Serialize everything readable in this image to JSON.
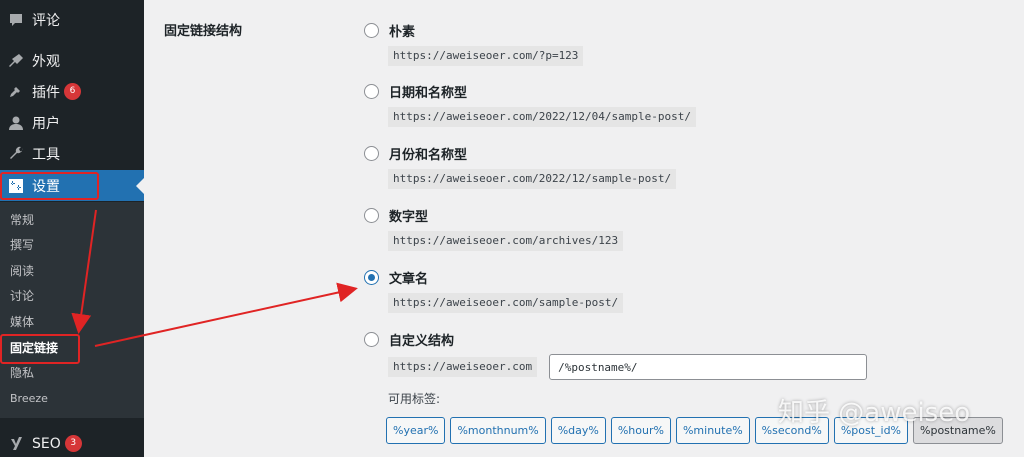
{
  "sidebar": {
    "items": [
      {
        "label": "评论",
        "icon": "comment-icon"
      },
      {
        "label": "外观",
        "icon": "appearance-icon"
      },
      {
        "label": "插件",
        "icon": "plugins-icon",
        "badge": "6"
      },
      {
        "label": "用户",
        "icon": "users-icon"
      },
      {
        "label": "工具",
        "icon": "tools-icon"
      },
      {
        "label": "设置",
        "icon": "settings-icon"
      },
      {
        "label": "SEO",
        "icon": "yoast-icon",
        "badge": "3"
      }
    ],
    "submenu": [
      "常规",
      "撰写",
      "阅读",
      "讨论",
      "媒体",
      "固定链接",
      "隐私",
      "Breeze"
    ]
  },
  "permalink": {
    "section_label": "固定链接结构",
    "options": [
      {
        "label": "朴素",
        "example": "https://aweiseoer.com/?p=123",
        "checked": false
      },
      {
        "label": "日期和名称型",
        "example": "https://aweiseoer.com/2022/12/04/sample-post/",
        "checked": false
      },
      {
        "label": "月份和名称型",
        "example": "https://aweiseoer.com/2022/12/sample-post/",
        "checked": false
      },
      {
        "label": "数字型",
        "example": "https://aweiseoer.com/archives/123",
        "checked": false
      },
      {
        "label": "文章名",
        "example": "https://aweiseoer.com/sample-post/",
        "checked": true
      },
      {
        "label": "自定义结构",
        "checked": false
      }
    ],
    "custom_base": "https://aweiseoer.com",
    "custom_value": "/%postname%/",
    "tags_label": "可用标签:",
    "tags": [
      "%year%",
      "%monthnum%",
      "%day%",
      "%hour%",
      "%minute%",
      "%second%",
      "%post_id%",
      "%postname%"
    ]
  },
  "watermark": "知乎 @aweiseo",
  "colors": {
    "sidebar_bg": "#1d2327",
    "accent": "#2271b1",
    "badge": "#d63638",
    "annotation": "#e02424"
  }
}
